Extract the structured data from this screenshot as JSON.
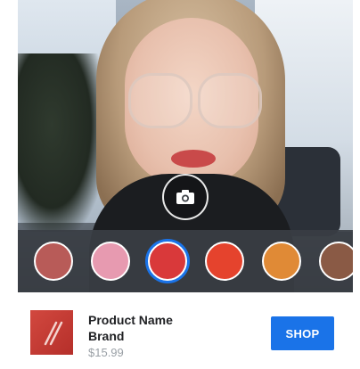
{
  "camera": {
    "capture_icon": "camera-icon"
  },
  "swatches": {
    "colors": [
      "#b85b58",
      "#e79ab0",
      "#d9393a",
      "#e5432d",
      "#e08a36",
      "#8a5a45"
    ],
    "selected_index": 2,
    "selection_color": "#1a73e8"
  },
  "product": {
    "name": "Product Name",
    "brand": "Brand",
    "price": "$15.99",
    "shop_label": "SHOP",
    "accent": "#1a73e8"
  }
}
